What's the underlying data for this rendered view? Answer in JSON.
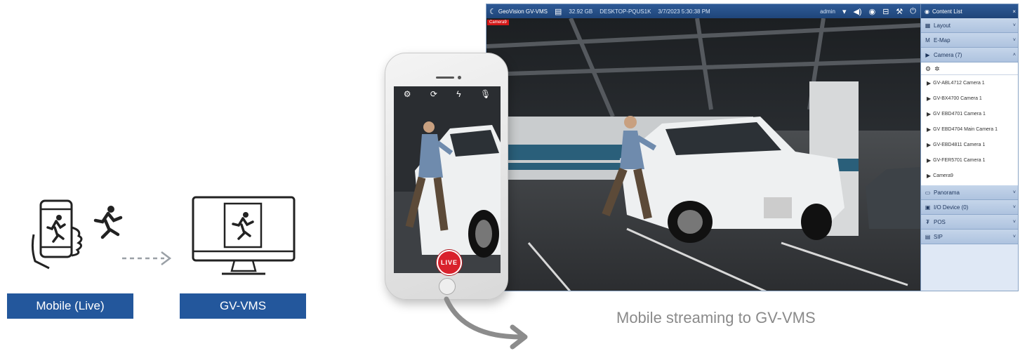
{
  "diagram": {
    "mobile_label": "Mobile (Live)",
    "vms_label": "GV-VMS"
  },
  "vms": {
    "brand": "GeoVision GV-VMS",
    "disk": "32.92 GB",
    "host": "DESKTOP-PQUS1K",
    "datetime": "3/7/2023 5:30:38 PM",
    "user": "admin",
    "camera_tag": "Camera9",
    "panel_title": "Content List",
    "sections_top": [
      {
        "label": "Layout",
        "icon": "layout-icon",
        "chevron": "˅"
      },
      {
        "label": "E-Map",
        "icon": "map-icon",
        "chevron": "˅"
      },
      {
        "label": "Camera (7)",
        "icon": "camera-icon",
        "chevron": "˄"
      }
    ],
    "cameras": [
      "GV-ABL4712 Camera 1",
      "GV-BX4700 Camera 1",
      "GV EBD4701 Camera 1",
      "GV EBD4704 Main Camera 1",
      "GV-EBD4811 Camera 1",
      "GV-FER5701 Camera 1",
      "Camera9"
    ],
    "sections_bottom": [
      {
        "label": "Panorama",
        "icon": "panorama-icon",
        "chevron": "˅"
      },
      {
        "label": "I/O Device (0)",
        "icon": "io-icon",
        "chevron": "˅"
      },
      {
        "label": "POS",
        "icon": "pos-icon",
        "chevron": "˅"
      },
      {
        "label": "SIP",
        "icon": "sip-icon",
        "chevron": "˅"
      }
    ]
  },
  "phone": {
    "live_label": "LIVE"
  },
  "caption": "Mobile streaming to GV-VMS",
  "colors": {
    "label_bg": "#23579c",
    "live_red": "#d9212c",
    "panel_bg": "#dfe8f5"
  }
}
